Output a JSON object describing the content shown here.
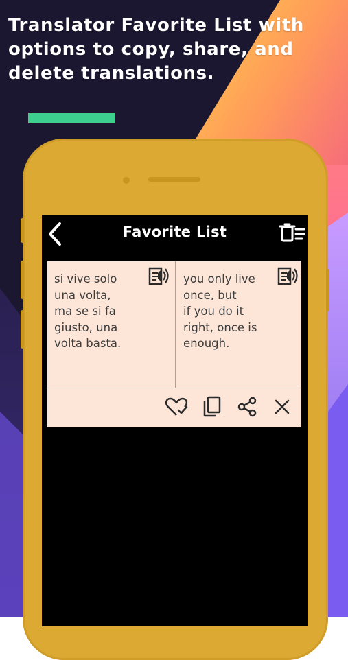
{
  "headline": "Translator Favorite List with options to copy, share, and delete translations.",
  "colors": {
    "accent_bar": "#3ccf8e",
    "phone_frame": "#dcaa33",
    "card_bg": "#fde6d8",
    "screen_bg": "#000000"
  },
  "app_bar": {
    "title": "Favorite List",
    "back_icon": "chevron-left-icon",
    "delete_all_icon": "trash-list-icon"
  },
  "favorites": [
    {
      "source_text": "si vive solo\nuna volta,\nma se si fa\ngiusto, una\nvolta basta.",
      "target_text": "you only live\nonce, but\nif you do it\nright, once is\nenough.",
      "speak_icon": "speaker-document-icon",
      "actions": [
        "heart-check-icon",
        "copy-icon",
        "share-icon",
        "close-icon"
      ]
    }
  ]
}
